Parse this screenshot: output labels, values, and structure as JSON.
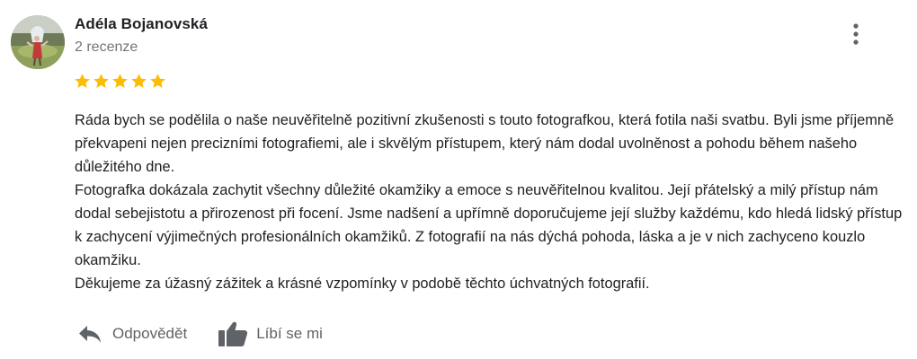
{
  "review": {
    "author": {
      "name": "Adéla Bojanovská",
      "meta": "2 recenze",
      "avatar_icon": "profile-photo"
    },
    "more_icon": "more-vertical-icon",
    "rating": {
      "value": 5,
      "max": 5,
      "star_color": "#fbbc04"
    },
    "paragraphs": [
      "Ráda bych se podělila o naše neuvěřitelně pozitivní zkušenosti s touto fotografkou, která fotila naši svatbu. Byli jsme příjemně překvapeni nejen precizními fotografiemi, ale i skvělým přístupem, který nám dodal uvolněnost a pohodu během našeho důležitého dne.",
      "Fotografka dokázala zachytit všechny důležité okamžiky a emoce s neuvěřitelnou kvalitou. Její přátelský a milý přístup nám dodal sebejistotu a přirozenost při focení. Jsme nadšení a upřímně doporučujeme její služby každému, kdo hledá lidský přístup k zachycení výjimečných profesionálních okamžiků. Z fotografií na nás dýchá pohoda, láska a je v nich zachyceno kouzlo okamžiku.",
      "Děkujeme za úžasný zážitek a krásné vzpomínky v podobě těchto úchvatných fotografií."
    ],
    "actions": {
      "reply_label": "Odpovědět",
      "reply_icon": "reply-icon",
      "like_label": "Líbí se mi",
      "like_icon": "thumbs-up-icon"
    }
  }
}
